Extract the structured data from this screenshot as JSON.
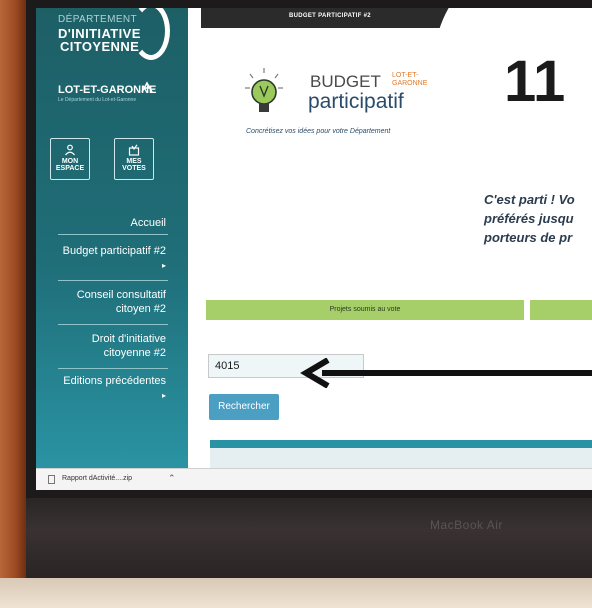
{
  "sidebar": {
    "dept_label": "DÉPARTEMENT",
    "logo_line1": "D'INITIATIVE",
    "logo_line2": "CITOYENNE",
    "lot_garonne": "LOT-ET-GARONNE",
    "lot_garonne_sub": "Le Département du Lot-et-Garonne",
    "buttons": [
      {
        "label": "MON ESPACE",
        "icon": "user-icon"
      },
      {
        "label": "MES VOTES",
        "icon": "vote-icon"
      }
    ],
    "menu": [
      {
        "label": "Accueil"
      },
      {
        "label": "Budget participatif #2"
      },
      {
        "label": "Conseil consultatif citoyen #2"
      },
      {
        "label": "Droit d'initiative citoyenne #2"
      },
      {
        "label": "Editions précédentes"
      }
    ]
  },
  "topbar": {
    "label": "BUDGET PARTICIPATIF #2"
  },
  "brand": {
    "budget": "BUDGET",
    "lot_garonne": "LOT-ET-GARONNE",
    "participatif": "participatif",
    "tagline": "Concrétisez vos idées pour votre Département"
  },
  "hero": {
    "number": "11",
    "intro_line1": "C'est parti ! Vo",
    "intro_line2": "préférés jusqu",
    "intro_line3": "porteurs de pr"
  },
  "tabs": [
    {
      "label": "Projets soumis au vote"
    }
  ],
  "search": {
    "value": "4015",
    "button_label": "Rechercher"
  },
  "download": {
    "filename": "Rapport dActivité....zip"
  },
  "device": {
    "label": "MacBook Air"
  },
  "colors": {
    "sidebar": "#1f6e78",
    "green": "#a6cf6a",
    "button": "#4a9fc3",
    "frame": "#8a3a1a"
  }
}
